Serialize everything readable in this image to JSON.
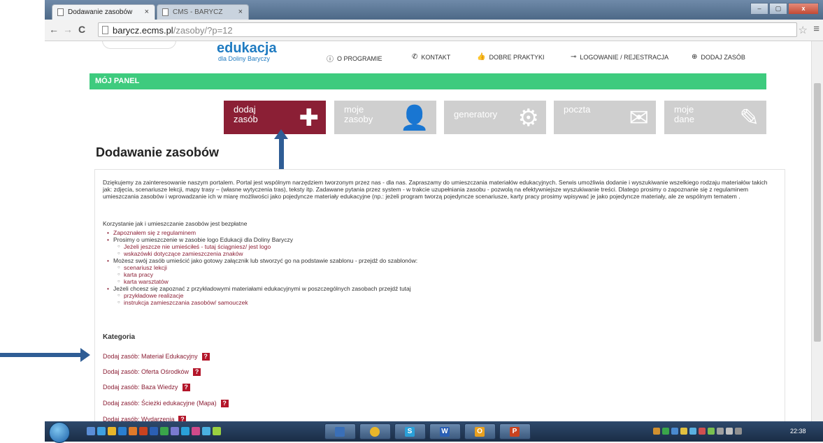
{
  "browser": {
    "tabs": [
      {
        "label": "Dodawanie zasobów",
        "active": true,
        "close": "×"
      },
      {
        "label": "CMS - BARYCZ",
        "active": false,
        "close": "×"
      }
    ],
    "back": "←",
    "forward": "→",
    "reload": "C",
    "url_host": "barycz.ecms.pl",
    "url_path": "/zasoby/?p=12",
    "star": "☆",
    "menu": "≡",
    "window_controls": [
      "‒",
      "▢",
      "x"
    ]
  },
  "site": {
    "logo_big": "edukacja",
    "logo_small": "dla Doliny Baryczy",
    "nav": [
      {
        "label": "O PROGRAMIE",
        "icon": "info-icon",
        "glyph": "ⓘ"
      },
      {
        "label": "KONTAKT",
        "icon": "phone-icon",
        "glyph": "✆"
      },
      {
        "label": "DOBRE PRAKTYKI",
        "icon": "thumb-up-icon",
        "glyph": "👍"
      },
      {
        "label": "LOGOWANIE / REJESTRACJA",
        "icon": "key-icon",
        "glyph": "⊸"
      },
      {
        "label": "DODAJ ZASÓB",
        "icon": "plus-circle-icon",
        "glyph": "⊕"
      }
    ],
    "panel_title": "MÓJ PANEL",
    "tiles": [
      {
        "label": "dodaj\nzasób",
        "icon": "plus-icon",
        "glyph": "✚",
        "active": true
      },
      {
        "label": "moje\nzasoby",
        "icon": "user-icon",
        "glyph": "👤",
        "active": false
      },
      {
        "label": "generatory",
        "icon": "gear-icon",
        "glyph": "⚙",
        "active": false
      },
      {
        "label": "poczta",
        "icon": "mail-icon",
        "glyph": "✉",
        "active": false
      },
      {
        "label": "moje\ndane",
        "icon": "edit-icon",
        "glyph": "✎",
        "active": false
      }
    ],
    "heading": "Dodawanie zasobów",
    "intro": "Dziękujemy za zainteresowanie naszym portalem. Portal jest wspólnym narzędziem tworzonym przez nas - dla nas. Zapraszamy do umieszczania materiałów edukacyjnych. Serwis umożliwia dodanie i wyszukiwanie wszelkiego rodzaju materiałów takich jak: zdjęcia, scenariusze lekcji, mapy trasy – (własne wytyczenia tras), teksty itp. Zadawane pytania przez system - w trakcie uzupełniania zasobu - pozwolą na efektywniejsze wyszukiwanie treści. Dlatego prosimy o zapoznanie się z regulaminem umieszczania zasobów i wprowadzanie ich w miarę możliwości jako pojedyncze materiały edukacyjne (np.: jeżeli program tworzą pojedyncze scenariusze, karty pracy prosimy wpisywać je jako pojedyncze materiały, ale ze wspólnym tematem .",
    "free_note": "Korzystanie jak i umieszczanie zasobów jest bezpłatne",
    "rules": [
      {
        "text": "Zapoznałem się z regulaminem",
        "link": true,
        "sub": false
      },
      {
        "text": "Prosimy o umieszczenie  w zasobie logo Edukacji dla Doliny Baryczy",
        "link": false,
        "sub": false
      },
      {
        "text": "Jeżeli jeszcze nie umieściłeś - tutaj ściągniesz/ jest logo",
        "link": true,
        "sub": true
      },
      {
        "text": "wskazówki dotyczące zamieszczenia znaków",
        "link": true,
        "sub": true
      },
      {
        "text": "Możesz swój zasób umieścić jako gotowy załącznik lub stworzyć go na podstawie szablonu - przejdź do szablonów:",
        "link": false,
        "sub": false
      },
      {
        "text": "scenariusz lekcji",
        "link": true,
        "sub": true
      },
      {
        "text": "karta pracy",
        "link": true,
        "sub": true
      },
      {
        "text": "karta warsztatów",
        "link": true,
        "sub": true
      },
      {
        "text": "Jeżeli chcesz się zapoznać z przykładowymi materiałami edukacyjnymi w poszczególnych zasobach przejdź tutaj",
        "link": false,
        "sub": false
      },
      {
        "text": "przykładowe realizacje",
        "link": true,
        "sub": true
      },
      {
        "text": "instrukcja zamieszczania zasobów/ samouczek",
        "link": true,
        "sub": true
      }
    ],
    "category_heading": "Kategoria",
    "categories": [
      {
        "label": "Dodaj zasób: Materiał Edukacyjny",
        "help": "?"
      },
      {
        "label": "Dodaj zasób: Oferta Ośrodków",
        "help": "?"
      },
      {
        "label": "Dodaj zasób: Baza Wiedzy",
        "help": "?"
      },
      {
        "label": "Dodaj zasób: Ścieżki edukacyjne (Mapa)",
        "help": "?"
      },
      {
        "label": "Dodaj zasób: Wydarzenia",
        "help": "?"
      }
    ]
  },
  "taskbar": {
    "clock": "22:38",
    "pinned": [
      {
        "name": "taskbar-app-1",
        "color": "#3a6fb7"
      },
      {
        "name": "taskbar-chrome",
        "color": "#e8b62a"
      },
      {
        "name": "taskbar-app-s",
        "color": "#2aa0d8",
        "glyph": "S"
      },
      {
        "name": "taskbar-word",
        "color": "#2b5fb4",
        "glyph": "W"
      },
      {
        "name": "taskbar-outlook",
        "color": "#e8a020",
        "glyph": "O"
      },
      {
        "name": "taskbar-powerpoint",
        "color": "#c9421f",
        "glyph": "P"
      }
    ]
  }
}
